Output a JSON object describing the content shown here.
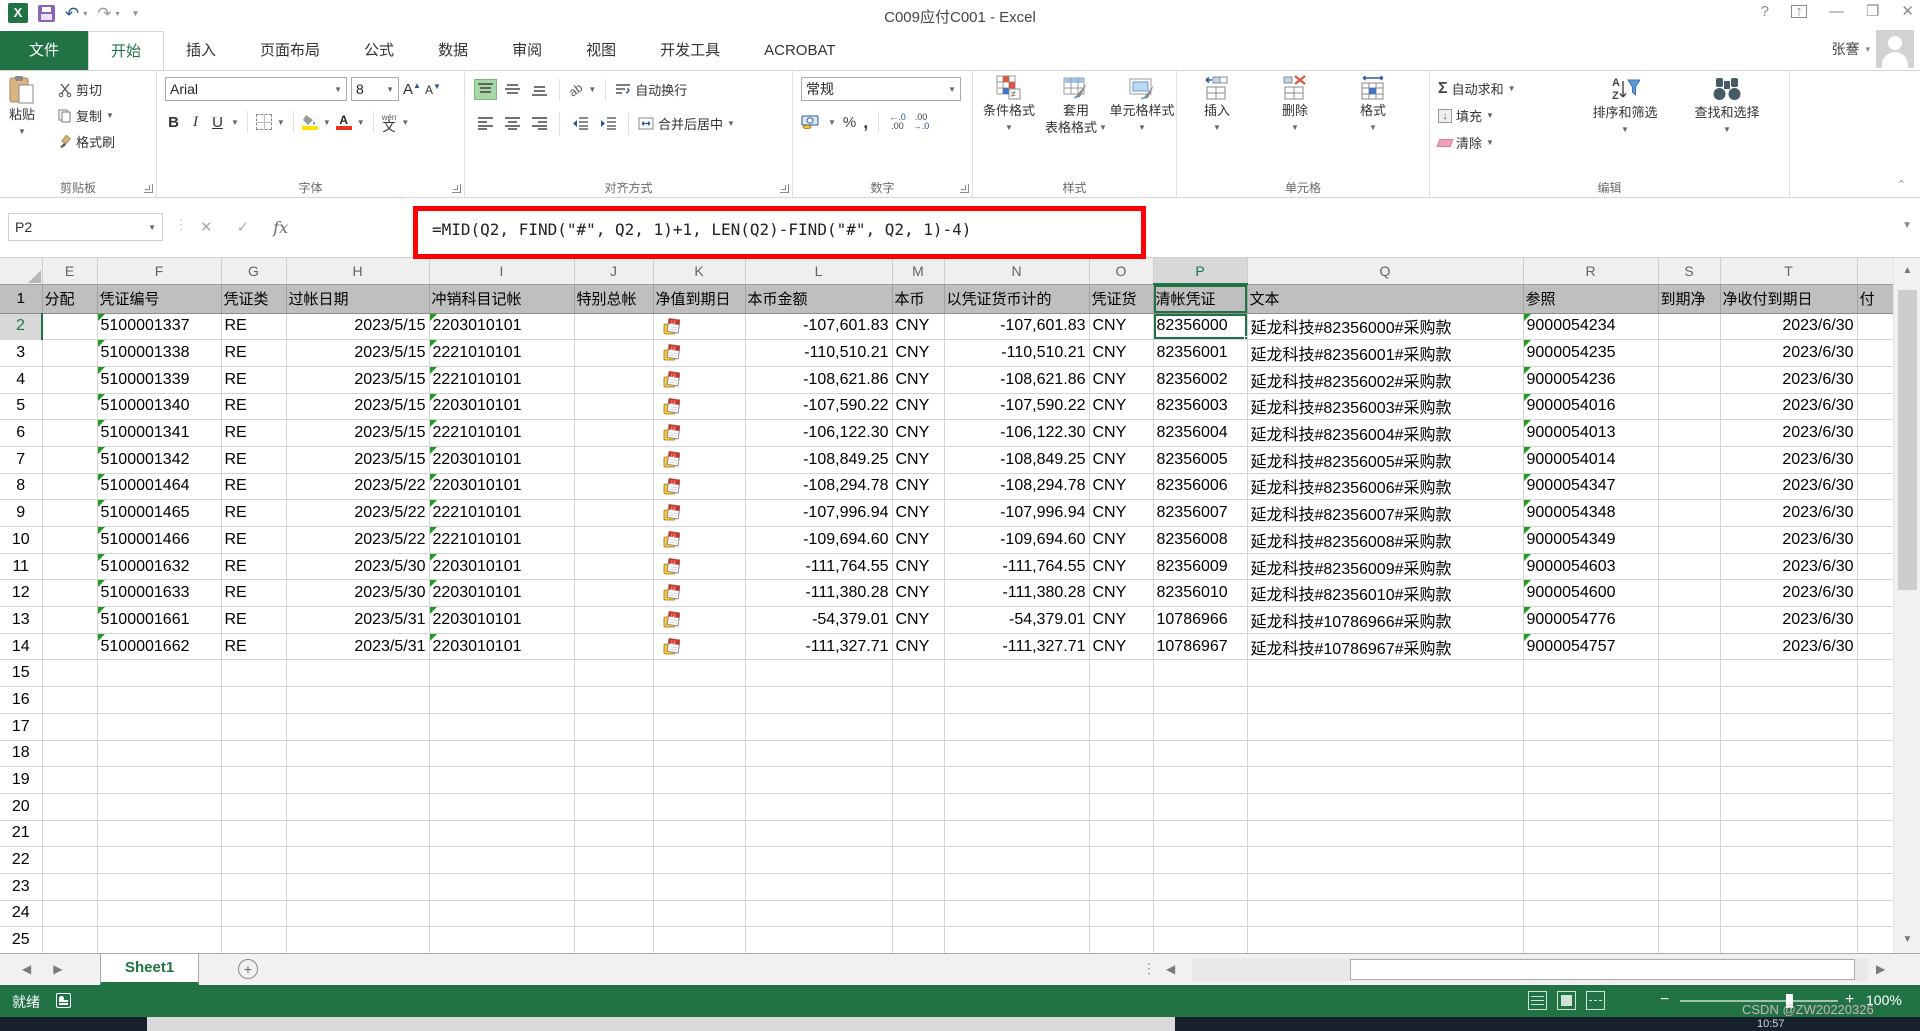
{
  "title_bar": {
    "title": "C009应付C001 - Excel",
    "help": "?"
  },
  "tabs": {
    "file": "文件",
    "items": [
      "开始",
      "插入",
      "页面布局",
      "公式",
      "数据",
      "审阅",
      "视图",
      "开发工具",
      "ACROBAT"
    ],
    "active": "开始",
    "user": "张謇"
  },
  "ribbon": {
    "clipboard": {
      "label": "剪贴板",
      "paste": "粘贴",
      "cut": "剪切",
      "copy": "复制",
      "format_painter": "格式刷"
    },
    "font": {
      "label": "字体",
      "font_name": "Arial",
      "font_size": "8",
      "bold": "B",
      "italic": "I",
      "underline": "U",
      "phonetic": "文",
      "phonetic_sup": "wén"
    },
    "alignment": {
      "label": "对齐方式",
      "wrap": "自动换行",
      "merge": "合并后居中"
    },
    "number": {
      "label": "数字",
      "format": "常规",
      "percent": "%",
      "comma": ",",
      "inc_dec_top": "←.0",
      "inc_dec_bot": ".00",
      "dec_dec_top": ".00",
      "dec_dec_bot": "→.0"
    },
    "styles": {
      "label": "样式",
      "conditional": "条件格式",
      "format_table_1": "套用",
      "format_table_2": "表格格式",
      "cell_styles": "单元格样式",
      "neq": "≠"
    },
    "cells": {
      "label": "单元格",
      "insert": "插入",
      "delete": "删除",
      "format": "格式"
    },
    "editing": {
      "label": "编辑",
      "autosum": "自动求和",
      "sigma": "Σ",
      "fill": "填充",
      "clear": "清除",
      "sort": "排序和筛选",
      "find": "查找和选择",
      "az_a": "A",
      "az_z": "Z"
    }
  },
  "formula_bar": {
    "name_box": "P2",
    "fx": "fx",
    "formula": "=MID(Q2, FIND(\"#\", Q2, 1)+1, LEN(Q2)-FIND(\"#\", Q2, 1)-4)"
  },
  "grid": {
    "selected_col": "P",
    "selected_row": 2,
    "active_cell": "P2",
    "k_icon_name": "date-calendar-icon",
    "columns": [
      {
        "letter": "E",
        "header": "分配"
      },
      {
        "letter": "F",
        "header": "凭证编号"
      },
      {
        "letter": "G",
        "header": "凭证类"
      },
      {
        "letter": "H",
        "header": "过帐日期"
      },
      {
        "letter": "I",
        "header": "冲销科目记帐"
      },
      {
        "letter": "J",
        "header": "特别总帐"
      },
      {
        "letter": "K",
        "header": "净值到期日"
      },
      {
        "letter": "L",
        "header": "本币金额"
      },
      {
        "letter": "M",
        "header": "本币"
      },
      {
        "letter": "N",
        "header": "以凭证货币计的"
      },
      {
        "letter": "O",
        "header": "凭证货"
      },
      {
        "letter": "P",
        "header": "清帐凭证"
      },
      {
        "letter": "Q",
        "header": "文本"
      },
      {
        "letter": "R",
        "header": "参照"
      },
      {
        "letter": "S",
        "header": "到期净"
      },
      {
        "letter": "T",
        "header": "净收付到期日"
      },
      {
        "letter": "",
        "header": "付"
      }
    ],
    "rows": [
      {
        "num": 2,
        "voucher": "5100001337",
        "type": "RE",
        "post_date": "2023/5/15",
        "offset_account": "2203010101",
        "amount_local": "-107,601.83",
        "currency_local": "CNY",
        "amount_doc": "-107,601.83",
        "currency_doc": "CNY",
        "clearing_doc": "82356000",
        "text": "延龙科技#82356000#采购款",
        "reference": "9000054234",
        "net_due_date": "2023/6/30"
      },
      {
        "num": 3,
        "voucher": "5100001338",
        "type": "RE",
        "post_date": "2023/5/15",
        "offset_account": "2221010101",
        "amount_local": "-110,510.21",
        "currency_local": "CNY",
        "amount_doc": "-110,510.21",
        "currency_doc": "CNY",
        "clearing_doc": "82356001",
        "text": "延龙科技#82356001#采购款",
        "reference": "9000054235",
        "net_due_date": "2023/6/30"
      },
      {
        "num": 4,
        "voucher": "5100001339",
        "type": "RE",
        "post_date": "2023/5/15",
        "offset_account": "2221010101",
        "amount_local": "-108,621.86",
        "currency_local": "CNY",
        "amount_doc": "-108,621.86",
        "currency_doc": "CNY",
        "clearing_doc": "82356002",
        "text": "延龙科技#82356002#采购款",
        "reference": "9000054236",
        "net_due_date": "2023/6/30"
      },
      {
        "num": 5,
        "voucher": "5100001340",
        "type": "RE",
        "post_date": "2023/5/15",
        "offset_account": "2203010101",
        "amount_local": "-107,590.22",
        "currency_local": "CNY",
        "amount_doc": "-107,590.22",
        "currency_doc": "CNY",
        "clearing_doc": "82356003",
        "text": "延龙科技#82356003#采购款",
        "reference": "9000054016",
        "net_due_date": "2023/6/30"
      },
      {
        "num": 6,
        "voucher": "5100001341",
        "type": "RE",
        "post_date": "2023/5/15",
        "offset_account": "2221010101",
        "amount_local": "-106,122.30",
        "currency_local": "CNY",
        "amount_doc": "-106,122.30",
        "currency_doc": "CNY",
        "clearing_doc": "82356004",
        "text": "延龙科技#82356004#采购款",
        "reference": "9000054013",
        "net_due_date": "2023/6/30"
      },
      {
        "num": 7,
        "voucher": "5100001342",
        "type": "RE",
        "post_date": "2023/5/15",
        "offset_account": "2203010101",
        "amount_local": "-108,849.25",
        "currency_local": "CNY",
        "amount_doc": "-108,849.25",
        "currency_doc": "CNY",
        "clearing_doc": "82356005",
        "text": "延龙科技#82356005#采购款",
        "reference": "9000054014",
        "net_due_date": "2023/6/30"
      },
      {
        "num": 8,
        "voucher": "5100001464",
        "type": "RE",
        "post_date": "2023/5/22",
        "offset_account": "2203010101",
        "amount_local": "-108,294.78",
        "currency_local": "CNY",
        "amount_doc": "-108,294.78",
        "currency_doc": "CNY",
        "clearing_doc": "82356006",
        "text": "延龙科技#82356006#采购款",
        "reference": "9000054347",
        "net_due_date": "2023/6/30"
      },
      {
        "num": 9,
        "voucher": "5100001465",
        "type": "RE",
        "post_date": "2023/5/22",
        "offset_account": "2221010101",
        "amount_local": "-107,996.94",
        "currency_local": "CNY",
        "amount_doc": "-107,996.94",
        "currency_doc": "CNY",
        "clearing_doc": "82356007",
        "text": "延龙科技#82356007#采购款",
        "reference": "9000054348",
        "net_due_date": "2023/6/30"
      },
      {
        "num": 10,
        "voucher": "5100001466",
        "type": "RE",
        "post_date": "2023/5/22",
        "offset_account": "2221010101",
        "amount_local": "-109,694.60",
        "currency_local": "CNY",
        "amount_doc": "-109,694.60",
        "currency_doc": "CNY",
        "clearing_doc": "82356008",
        "text": "延龙科技#82356008#采购款",
        "reference": "9000054349",
        "net_due_date": "2023/6/30"
      },
      {
        "num": 11,
        "voucher": "5100001632",
        "type": "RE",
        "post_date": "2023/5/30",
        "offset_account": "2203010101",
        "amount_local": "-111,764.55",
        "currency_local": "CNY",
        "amount_doc": "-111,764.55",
        "currency_doc": "CNY",
        "clearing_doc": "82356009",
        "text": "延龙科技#82356009#采购款",
        "reference": "9000054603",
        "net_due_date": "2023/6/30"
      },
      {
        "num": 12,
        "voucher": "5100001633",
        "type": "RE",
        "post_date": "2023/5/30",
        "offset_account": "2203010101",
        "amount_local": "-111,380.28",
        "currency_local": "CNY",
        "amount_doc": "-111,380.28",
        "currency_doc": "CNY",
        "clearing_doc": "82356010",
        "text": "延龙科技#82356010#采购款",
        "reference": "9000054600",
        "net_due_date": "2023/6/30"
      },
      {
        "num": 13,
        "voucher": "5100001661",
        "type": "RE",
        "post_date": "2023/5/31",
        "offset_account": "2203010101",
        "amount_local": "-54,379.01",
        "currency_local": "CNY",
        "amount_doc": "-54,379.01",
        "currency_doc": "CNY",
        "clearing_doc": "10786966",
        "text": "延龙科技#10786966#采购款",
        "reference": "9000054776",
        "net_due_date": "2023/6/30"
      },
      {
        "num": 14,
        "voucher": "5100001662",
        "type": "RE",
        "post_date": "2023/5/31",
        "offset_account": "2203010101",
        "amount_local": "-111,327.71",
        "currency_local": "CNY",
        "amount_doc": "-111,327.71",
        "currency_doc": "CNY",
        "clearing_doc": "10786967",
        "text": "延龙科技#10786967#采购款",
        "reference": "9000054757",
        "net_due_date": "2023/6/30"
      }
    ],
    "empty_rows": [
      15,
      16,
      17,
      18,
      19,
      20,
      21,
      22,
      23,
      24,
      25
    ]
  },
  "sheet_bar": {
    "tab": "Sheet1",
    "add": "+"
  },
  "status_bar": {
    "ready": "就绪",
    "zoom_label": "100%",
    "watermark": "CSDN @ZW20220326"
  },
  "taskbar": {
    "time": "10:57"
  },
  "colors": {
    "excel_green": "#217346",
    "highlight_red": "#FB0207",
    "header_gray": "#BFBFBF",
    "triangle_green": "#1E9C1E"
  }
}
